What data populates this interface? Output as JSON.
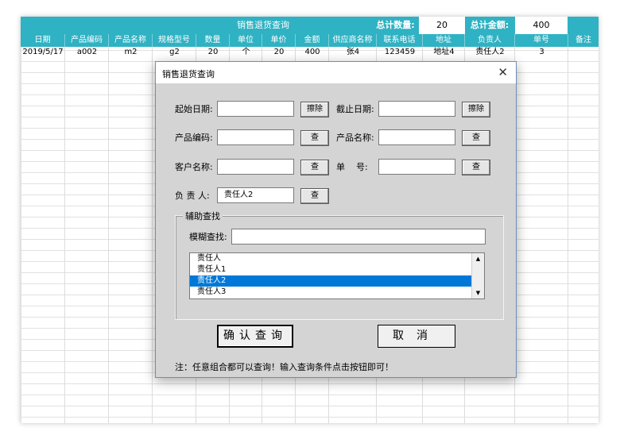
{
  "sheet": {
    "title": "销售退货查询",
    "total_qty_label": "总计数量:",
    "total_qty_value": "20",
    "total_amount_label": "总计金额:",
    "total_amount_value": "400",
    "headers": [
      "日期",
      "产品编码",
      "产品名称",
      "规格型号",
      "数量",
      "单位",
      "单价",
      "金额",
      "供应商名称",
      "联系电话",
      "地址",
      "负责人",
      "单号",
      "备注"
    ],
    "rows": [
      [
        "2019/5/17",
        "a002",
        "m2",
        "g2",
        "20",
        "个",
        "20",
        "400",
        "张4",
        "123459",
        "地址4",
        "责任人2",
        "3",
        ""
      ]
    ]
  },
  "dialog": {
    "title": "销售退货查询",
    "close_icon": "close-icon",
    "start_date_label": "起始日期:",
    "start_date_value": "",
    "clear_label_1": "擦除",
    "end_date_label": "截止日期:",
    "end_date_value": "",
    "clear_label_2": "擦除",
    "product_code_label": "产品编码:",
    "product_code_value": "",
    "product_name_label": "产品名称:",
    "product_name_value": "",
    "customer_label": "客户名称:",
    "customer_value": "",
    "order_no_label": "单    号:",
    "order_no_value": "",
    "owner_label": "负 责 人:",
    "owner_value": "责任人2",
    "search_label": "查",
    "group_title": "辅助查找",
    "fuzzy_label": "模糊查找:",
    "fuzzy_value": "",
    "list_items": [
      "责任人",
      "责任人1",
      "责任人2",
      "责任人3"
    ],
    "selected_item": "责任人2",
    "confirm_label": "确认查询",
    "cancel_label": "取消",
    "note": "注：任意组合都可以查询！输入查询条件点击按钮即可！"
  }
}
